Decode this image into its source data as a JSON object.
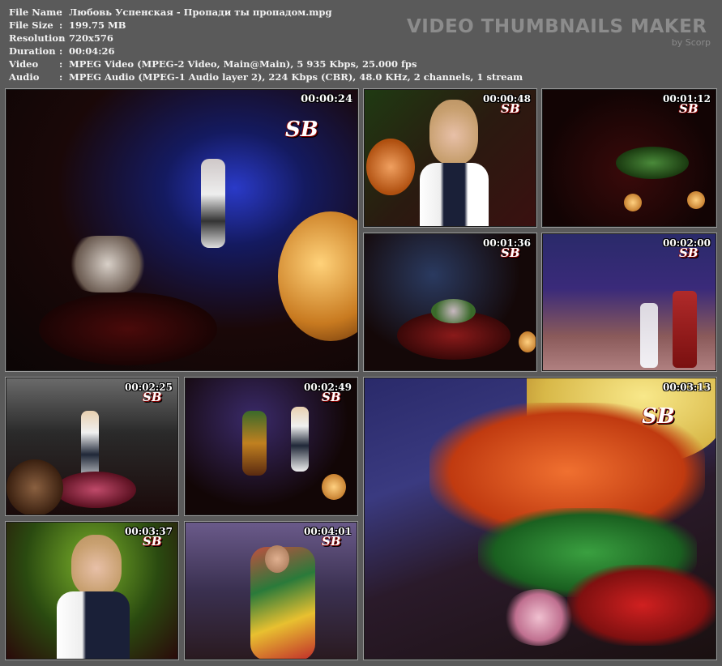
{
  "info": {
    "file_name": {
      "label": "File Name",
      "value": "Любовь Успенская - Пропади ты пропадом.mpg"
    },
    "file_size": {
      "label": "File Size",
      "value": "199.75 MB"
    },
    "resolution": {
      "label": "Resolution",
      "value": "720x576"
    },
    "duration": {
      "label": "Duration",
      "value": "00:04:26"
    },
    "video": {
      "label": "Video",
      "value": "MPEG Video (MPEG-2 Video, Main@Main), 5 935 Kbps, 25.000 fps"
    },
    "audio": {
      "label": "Audio",
      "value": "MPEG Audio (MPEG-1 Audio layer 2), 224 Kbps (CBR), 48.0 KHz, 2 channels, 1 stream"
    },
    "separator": ":"
  },
  "brand": {
    "title": "VIDEO THUMBNAILS MAKER",
    "subtitle": "by Scorp"
  },
  "thumbnails": [
    {
      "time": "00:00:24",
      "logo": "SB"
    },
    {
      "time": "00:00:48",
      "logo": "SB"
    },
    {
      "time": "00:01:12",
      "logo": "SB"
    },
    {
      "time": "00:01:36",
      "logo": "SB"
    },
    {
      "time": "00:02:00",
      "logo": "SB"
    },
    {
      "time": "00:02:25",
      "logo": "SB"
    },
    {
      "time": "00:02:49",
      "logo": "SB"
    },
    {
      "time": "00:03:13",
      "logo": "SB"
    },
    {
      "time": "00:03:37",
      "logo": "SB"
    },
    {
      "time": "00:04:01",
      "logo": "SB"
    }
  ]
}
